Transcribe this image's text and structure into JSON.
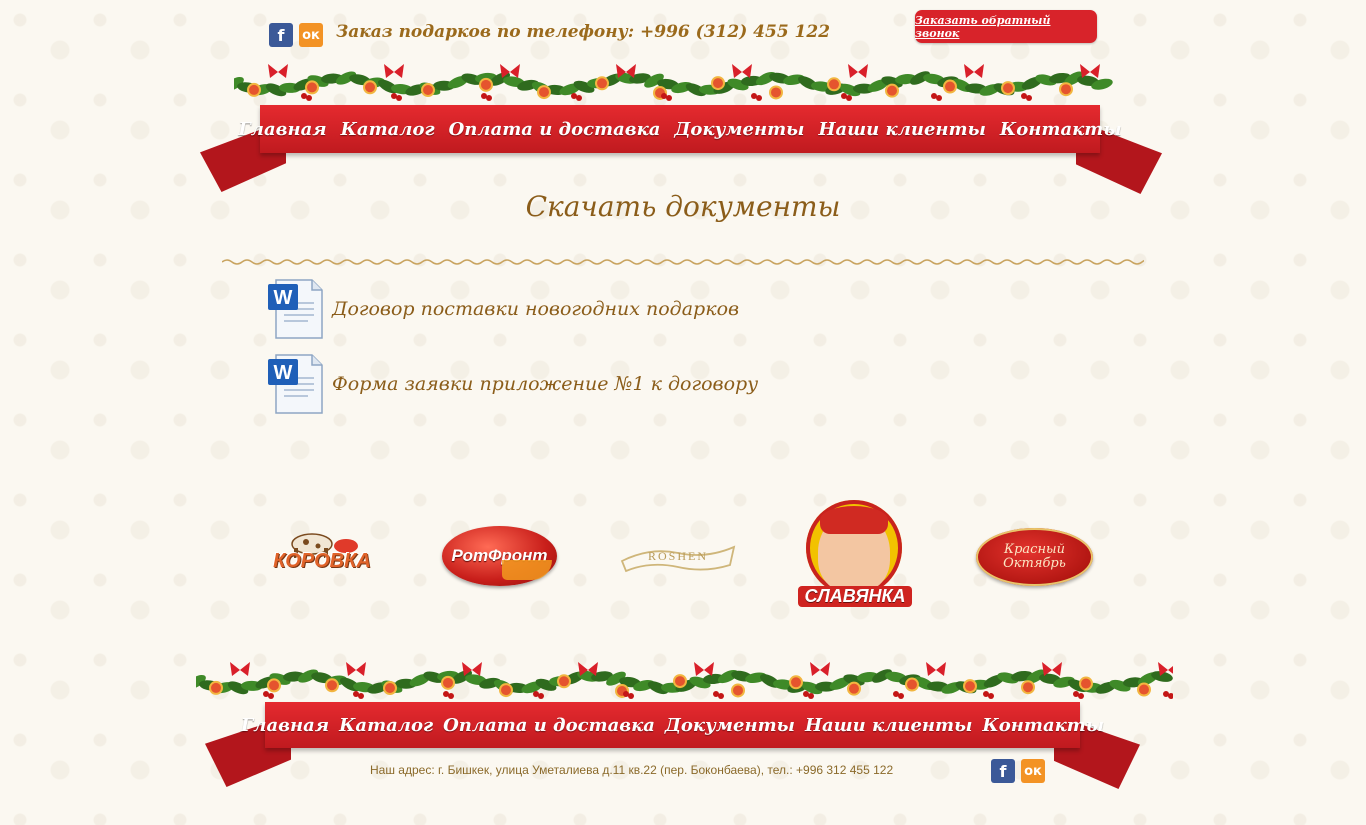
{
  "header": {
    "phone_text": "Заказ подарков по телефону: +996 (312) 455 122",
    "callback_label": "Заказать обратный звонок",
    "social": [
      "f",
      "ок"
    ]
  },
  "nav": {
    "items": [
      "Главная",
      "Каталог",
      "Оплата и доставка",
      "Документы",
      "Наши клиенты",
      "Контакты"
    ]
  },
  "page": {
    "title": "Скачать документы",
    "documents": [
      "Договор поставки новогодних подарков",
      "Форма заявки приложение №1 к договору"
    ]
  },
  "brands": [
    {
      "name": "Коровка",
      "label": "КОРОВКА"
    },
    {
      "name": "Рот Фронт",
      "label": "РотФронт"
    },
    {
      "name": "Roshen",
      "label": "ROSHEN"
    },
    {
      "name": "Славянка",
      "label": "СЛАВЯНКА"
    },
    {
      "name": "Красный Октябрь",
      "label": "Красный Октябрь"
    }
  ],
  "footer": {
    "nav": [
      "Главная",
      "Каталог",
      "Оплата и доставка",
      "Документы",
      "Наши клиенты",
      "Контакты"
    ],
    "address": "Наш адрес: г. Бишкек, улица Уметалиева д.11 кв.22 (пер. Боконбаева), тел.: +996 312 455 122",
    "social": [
      "f",
      "ок"
    ]
  },
  "colors": {
    "accent": "#d8232a",
    "text_gold": "#8b5d1a",
    "background": "#fbf8f1"
  },
  "icons": [
    "facebook-icon",
    "odnoklassniki-icon",
    "word-document-icon"
  ]
}
